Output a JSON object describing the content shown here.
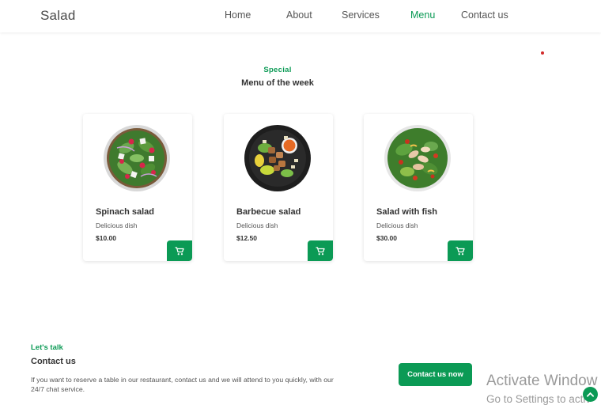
{
  "brand": {
    "logo": "Salad",
    "accent": "#0b9a55"
  },
  "nav": {
    "items": [
      {
        "label": "Home",
        "active": false
      },
      {
        "label": "About",
        "active": false
      },
      {
        "label": "Services",
        "active": false
      },
      {
        "label": "Menu",
        "active": true
      },
      {
        "label": "Contact us",
        "active": false
      }
    ]
  },
  "menu": {
    "subtitle": "Special",
    "title": "Menu of the week",
    "items": [
      {
        "name": "Spinach salad",
        "description": "Delicious dish",
        "price": "$10.00",
        "icon": "cart-icon"
      },
      {
        "name": "Barbecue salad",
        "description": "Delicious dish",
        "price": "$12.50",
        "icon": "cart-icon"
      },
      {
        "name": "Salad with fish",
        "description": "Delicious dish",
        "price": "$30.00",
        "icon": "cart-icon"
      }
    ]
  },
  "contact": {
    "subtitle": "Let's talk",
    "title": "Contact us",
    "text": "If you want to reserve a table in our restaurant, contact us and we will attend to you quickly, with our 24/7 chat service.",
    "button_label": "Contact us now"
  },
  "watermark": {
    "line1": "Activate Window",
    "line2": "Go to Settings to activ"
  },
  "scroll_top_icon": "chevron-up-icon"
}
